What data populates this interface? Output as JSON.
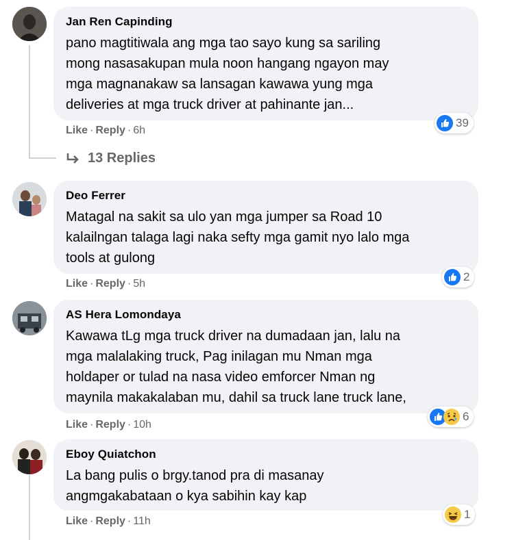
{
  "comments": [
    {
      "author": "Jan Ren Capinding",
      "text": "pano magtitiwala ang mga tao sayo kung sa sariling\nmong nasasakupan mula noon hangang ngayon may\nmga magnanakaw sa lansagan kawawa yung mga\ndeliveries at mga truck driver at pahinante jan...",
      "like": "Like",
      "reply": "Reply",
      "time": "6h",
      "reaction_count": "39",
      "reactions": [
        "like-icon"
      ]
    },
    {
      "author": "Deo Ferrer",
      "text": "Matagal na sakit sa ulo yan mga jumper sa Road 10\nkalailngan talaga lagi naka sefty mga gamit nyo lalo mga\ntools at gulong",
      "like": "Like",
      "reply": "Reply",
      "time": "5h",
      "reaction_count": "2",
      "reactions": [
        "like-icon"
      ]
    },
    {
      "author": "AS Hera Lomondaya",
      "text": "Kawawa tLg mga truck driver na dumadaan jan, lalu na\nmga malalaking truck, Pag inilagan mu Nman mga\nholdaper or tulad na nasa video emforcer Nman ng\nmaynila makakalaban mu, dahil sa truck lane truck lane,",
      "like": "Like",
      "reply": "Reply",
      "time": "10h",
      "reaction_count": "6",
      "reactions": [
        "like-icon",
        "sad-icon"
      ]
    },
    {
      "author": "Eboy Quiatchon",
      "text": "La bang pulis o brgy.tanod pra di masanay\nangmgakabataan o kya sabihin kay kap",
      "like": "Like",
      "reply": "Reply",
      "time": "11h",
      "reaction_count": "1",
      "reactions": [
        "haha-icon"
      ]
    }
  ],
  "replies_link": "13 Replies",
  "colors": {
    "bubble": "#f0f2f5",
    "meta_text": "#65676b",
    "like_blue": "#1877f2",
    "emoji_yellow": "#f7c948",
    "thread_line": "#ced0d4"
  },
  "separator": "·"
}
